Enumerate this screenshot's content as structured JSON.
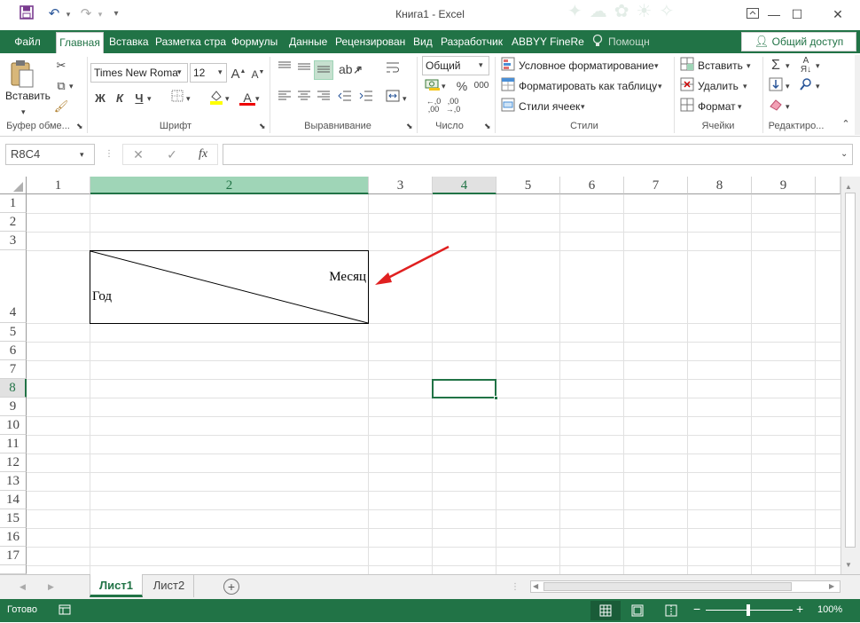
{
  "window": {
    "title": "Книга1 - Excel",
    "minimize": "—",
    "maximize": "☐",
    "close": "✕"
  },
  "tabs": [
    "Файл",
    "Главная",
    "Вставка",
    "Разметка стра",
    "Формулы",
    "Данные",
    "Рецензирован",
    "Вид",
    "Разработчик",
    "ABBYY FineRea",
    "Помощн"
  ],
  "share_label": "Общий доступ",
  "ribbon": {
    "clipboard": {
      "paste": "Вставить",
      "group": "Буфер обме..."
    },
    "font": {
      "name": "Times New Roma",
      "size": "12",
      "bold": "Ж",
      "italic": "К",
      "underline": "Ч",
      "group": "Шрифт"
    },
    "alignment": {
      "group": "Выравнивание"
    },
    "number": {
      "format": "Общий",
      "percent": "%",
      "thousands": "000",
      "group": "Число"
    },
    "styles": {
      "conditional": "Условное форматирование",
      "as_table": "Форматировать как таблицу",
      "cell_styles": "Стили ячеек",
      "group": "Стили"
    },
    "cells": {
      "insert": "Вставить",
      "delete": "Удалить",
      "format": "Формат",
      "group": "Ячейки"
    },
    "editing": {
      "group": "Редактиро..."
    }
  },
  "formula_bar": {
    "name_box": "R8C4",
    "cancel": "✕",
    "enter": "✓",
    "fx": "fx",
    "value": ""
  },
  "columns": [
    "1",
    "2",
    "3",
    "4",
    "5",
    "6",
    "7",
    "8",
    "9"
  ],
  "rows": [
    "1",
    "2",
    "3",
    "4",
    "5",
    "6",
    "7",
    "8",
    "9",
    "10",
    "11",
    "12",
    "13",
    "14",
    "15",
    "16",
    "17"
  ],
  "cells": {
    "month": "Месяц",
    "year": "Год"
  },
  "sheets": [
    "Лист1",
    "Лист2"
  ],
  "status": {
    "ready": "Готово",
    "zoom": "100%"
  },
  "colors": {
    "accent": "#217346",
    "selected_col": "#9fd5b7",
    "arrow": "#e02020"
  }
}
